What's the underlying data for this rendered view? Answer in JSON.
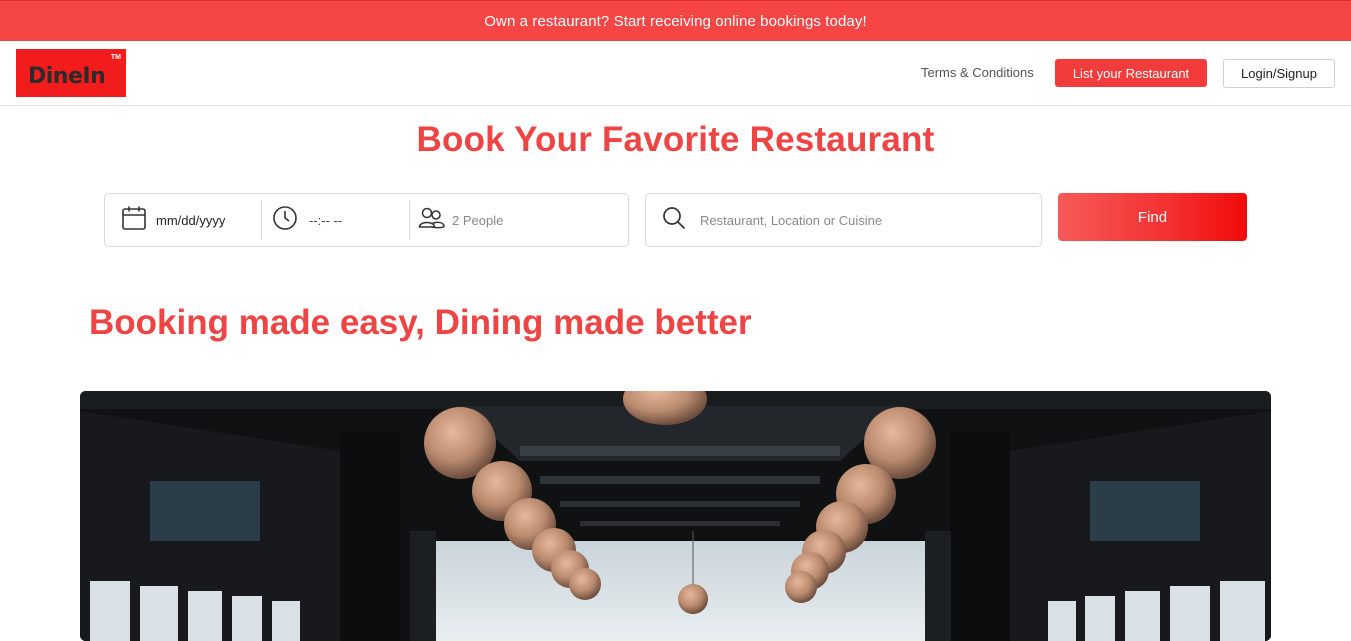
{
  "promo": {
    "text": "Own a restaurant? Start receiving online bookings today!"
  },
  "header": {
    "logo_text": "DineIn",
    "logo_tm": "TM",
    "nav": {
      "terms": "Terms & Conditions",
      "list_restaurant": "List your Restaurant",
      "login": "Login/Signup"
    }
  },
  "hero": {
    "title": "Book Your Favorite Restaurant"
  },
  "search": {
    "date_value": "mm/dd/yyyy",
    "time_value": "--:-- --",
    "people_value": "2 People",
    "query_placeholder": "Restaurant, Location or Cuisine",
    "find_label": "Find",
    "icons": {
      "date": "calendar-icon",
      "time": "clock-icon",
      "people": "people-icon",
      "query": "search-icon"
    }
  },
  "tagline": "Booking made easy, Dining made better",
  "colors": {
    "brand_red": "#ef4444",
    "logo_bg": "#f21c1c",
    "promo_bg": "#f54545"
  }
}
